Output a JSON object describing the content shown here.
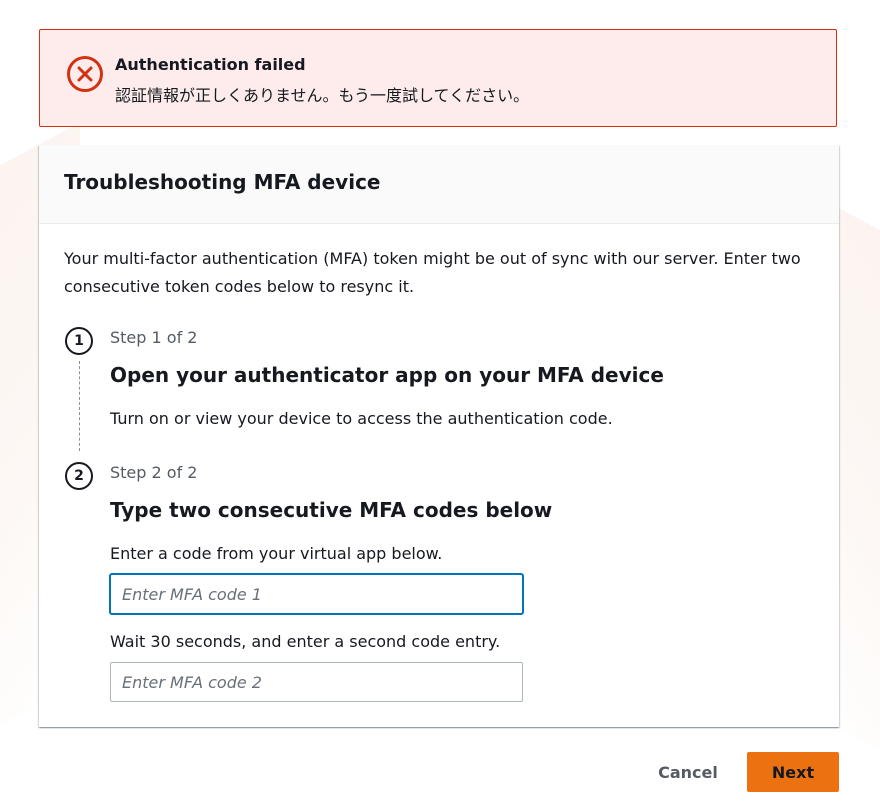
{
  "alert": {
    "icon": "error-x-icon",
    "title": "Authentication failed",
    "message": "認証情報が正しくありません。もう一度試してください。",
    "color": "#d13212"
  },
  "card": {
    "title": "Troubleshooting MFA device",
    "description": "Your multi-factor authentication (MFA) token might be out of sync with our server. Enter two consecutive token codes below to resync it."
  },
  "steps": [
    {
      "number": "1",
      "label": "Step 1 of 2",
      "heading": "Open your authenticator app on your MFA device",
      "text": "Turn on or view your device to access the authentication code."
    },
    {
      "number": "2",
      "label": "Step 2 of 2",
      "heading": "Type two consecutive MFA codes below",
      "input1_label": "Enter a code from your virtual app below.",
      "input1_placeholder": "Enter MFA code 1",
      "input1_value": "",
      "input2_label": "Wait 30 seconds, and enter a second code entry.",
      "input2_placeholder": "Enter MFA code 2",
      "input2_value": ""
    }
  ],
  "footer": {
    "cancel_label": "Cancel",
    "next_label": "Next",
    "accent_color": "#ec7211"
  }
}
